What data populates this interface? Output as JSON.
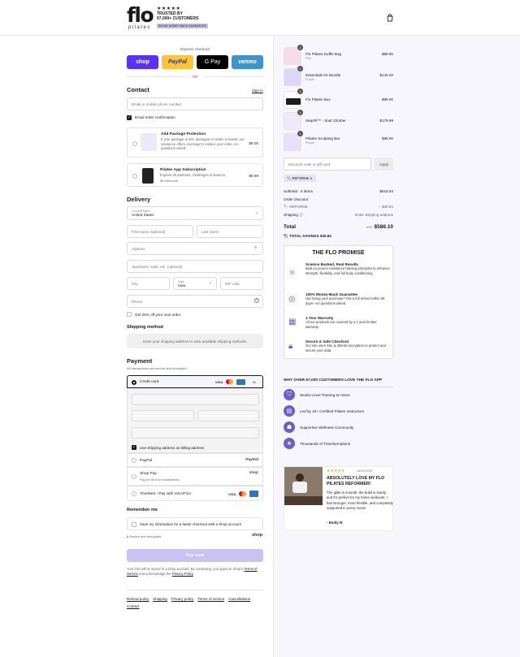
{
  "brand": {
    "logo_main": "flo",
    "logo_sub": "pilates",
    "rating_stars": "★★★★★",
    "trusted_line1": "TRUSTED BY",
    "trusted_line2": "67,000+ CUSTOMERS",
    "guarantee_badge": "99-DAY MONEY BACK GUARANTEE"
  },
  "express": {
    "label": "Express checkout",
    "shop": "shop",
    "paypal": "PayPal",
    "gpay": "G Pay",
    "venmo": "venmo",
    "or": "OR"
  },
  "contact": {
    "heading": "Contact",
    "signin": "Sign in",
    "email_placeholder": "Email or mobile phone number",
    "email_offers": "Email order confirmation"
  },
  "addons": [
    {
      "title": "Add Package Protection",
      "desc": "If your package is lost, damaged or stolen in transit, our insurance offers coverage to replace your order, no questions asked.",
      "price": "$9.00"
    },
    {
      "title": "Pilates App Subscription",
      "desc": "Explore all workouts, challenges & features.",
      "sub": "$9.99/month",
      "price": "$9.99"
    }
  ],
  "delivery": {
    "heading": "Delivery",
    "country_label": "Country/Region",
    "country_value": "United States",
    "first_name": "First name (optional)",
    "last_name": "Last name",
    "address": "Address",
    "apartment": "Apartment, suite, etc. (optional)",
    "city": "City",
    "state_label": "State",
    "state_value": "Iowa",
    "zip": "ZIP code",
    "phone": "Phone",
    "discount_offer": "Get 25% off your next order"
  },
  "shipping_method": {
    "heading": "Shipping method",
    "placeholder": "Enter your shipping address to view available shipping methods."
  },
  "payment": {
    "heading": "Payment",
    "secure_note": "All transactions are secure and encrypted.",
    "credit_card": "Credit card",
    "card_more": "+6",
    "billing_same": "Use shipping address as billing address",
    "paypal": "PayPal",
    "paypal_logo": "PayPal",
    "shop_pay": "Shop Pay",
    "shop_pay_sub": "Pay in full or in installments",
    "shop_logo": "shop",
    "truemed": "TrueMed - Pay with HSA/FSA"
  },
  "remember": {
    "heading": "Remember me",
    "save_info": "Save my information for a faster checkout with a Shop account",
    "secure": "Secure and encrypted",
    "shop_logo": "shop"
  },
  "pay_now": "Pay now",
  "legal": {
    "text1": "Your info will be saved to a Shop account. By continuing, you agree to Shop's",
    "terms": "Terms of Service",
    "and": "and acknowledge the",
    "privacy": "Privacy Policy",
    "dot": "."
  },
  "footer_links": [
    "Refund policy",
    "Shipping",
    "Privacy policy",
    "Terms of service",
    "Cancellations",
    "Contact"
  ],
  "cart": {
    "items": [
      {
        "name": "Flo Pilates Duffle Bag",
        "variant": "Pink",
        "price": "$88.95",
        "qty": "1"
      },
      {
        "name": "Essentials Kit Bundle",
        "variant": "Purple",
        "price": "$140.00",
        "qty": "1"
      },
      {
        "name": "Flo Pilates Box",
        "variant": "",
        "price": "$99.00",
        "qty": "1"
      },
      {
        "name": "StepFit™ - Stair Climber",
        "variant": "",
        "price": "$179.99",
        "qty": "1"
      },
      {
        "name": "Pilates Sculpting Bar",
        "variant": "Purple",
        "price": "$99.00",
        "qty": "1"
      }
    ],
    "discount_placeholder": "Discount code or gift card",
    "apply": "Apply",
    "applied_code": "REFORM5",
    "subtotal_label": "Subtotal · 5 items",
    "subtotal_value": "$616.94",
    "order_discount_label": "Order discount",
    "code_label": "REFORM5",
    "code_value": "− $30.84",
    "shipping_label": "Shipping",
    "shipping_value": "Enter shipping address",
    "total_label": "Total",
    "currency": "USD",
    "total_value": "$586.10",
    "savings_label": "TOTAL SAVINGS",
    "savings_value": "$30.84"
  },
  "promise": {
    "title": "THE FLO PROMISE",
    "items": [
      {
        "title": "Science Backed, Real Results",
        "text": "Built on proven resistance training principles to enhance strength, flexibility, and full body conditioning"
      },
      {
        "title": "100% Money-Back Guarantee",
        "text": "Not loving your purchase? Get a full refund within 99 days—no questions asked."
      },
      {
        "title": "1 Year Warranty",
        "text": "All our products are covered by a 1 year limited warranty."
      },
      {
        "title": "Secure & Safe Checkout",
        "text": "Our site uses SSL & 256-bit encryption to protect and secure your data."
      }
    ]
  },
  "why": {
    "title": "WHY OVER 67,000 CUSTOMERS LOVE THE FLO APP",
    "items": [
      "Studio-Level Training at Home",
      "Led by 10+ Certified Pilates Instructors",
      "Supportive Wellness Community",
      "Thousands of Transformations"
    ]
  },
  "review": {
    "stars": "★★★★★",
    "date": "04/02/2025",
    "title": "ABSOLUTELY LOVE MY FLO PILATES REFORMER!",
    "text": "The glide is smooth, the build is sturdy, and it's perfect for my home workouts. I feel stronger, more flexible, and completely supported in every move!",
    "author": "- Emily R."
  },
  "colors": {
    "accent": "#6c5fc7",
    "pay_now_bg": "#c9c2f2",
    "shop_purple": "#5a31f4",
    "paypal_yellow": "#ffc439",
    "venmo_blue": "#3d95ce"
  }
}
